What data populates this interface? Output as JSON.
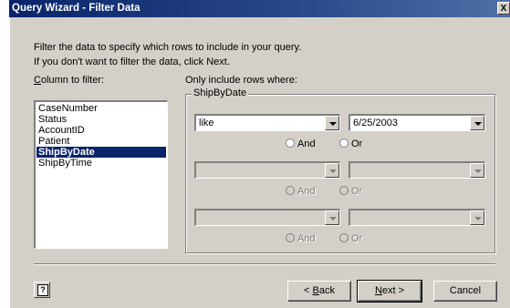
{
  "window": {
    "title": "Query Wizard - Filter Data",
    "close_label": "X"
  },
  "intro": {
    "line1": "Filter the data to specify which rows to include in your query.",
    "line2": "If you don't want to filter the data, click Next."
  },
  "columns": {
    "label": "Column to filter:",
    "label_accel": "C",
    "label_rest": "olumn to filter:",
    "items": [
      "CaseNumber",
      "Status",
      "AccountID",
      "Patient",
      "ShipByDate",
      "ShipByTime"
    ],
    "selected": "ShipByDate"
  },
  "filter": {
    "heading": "Only include rows where:",
    "group_label": "ShipByDate",
    "rows": [
      {
        "operator": "like",
        "value": "6/25/2003",
        "and": "And",
        "or": "Or"
      },
      {
        "operator": "",
        "value": "",
        "and": "And",
        "or": "Or"
      },
      {
        "operator": "",
        "value": ""
      }
    ],
    "row3_and": "And",
    "row3_or": "Or"
  },
  "buttons": {
    "help_icon": "?",
    "back_accel": "B",
    "back_prefix": "< ",
    "back_rest": "ack",
    "next_accel": "N",
    "next_rest": "ext >",
    "cancel": "Cancel"
  }
}
